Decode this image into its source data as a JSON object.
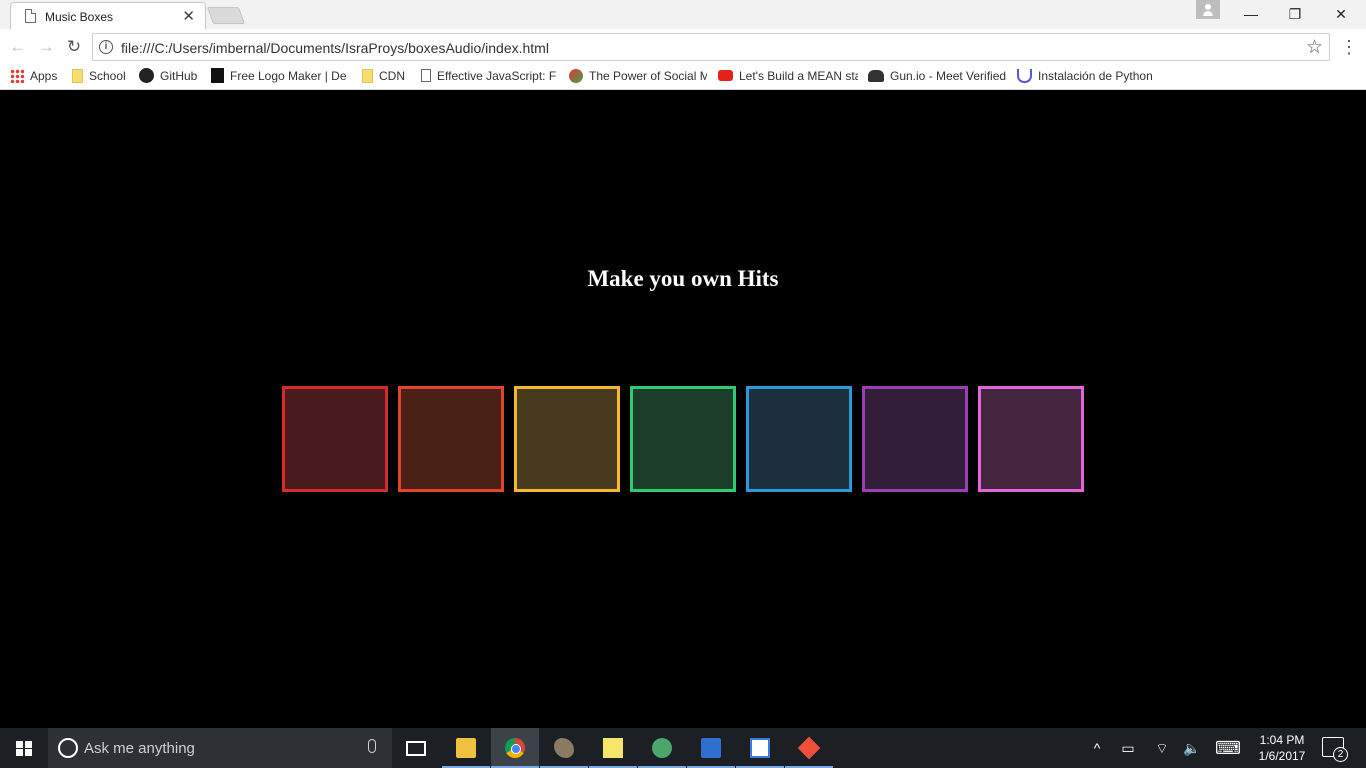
{
  "browser": {
    "tab_title": "Music Boxes",
    "tab_close": "✕",
    "window_controls": {
      "minimize": "—",
      "maximize": "❐",
      "close": "✕"
    },
    "url": "file:///C:/Users/imbernal/Documents/IsraProys/boxesAudio/index.html",
    "nav": {
      "back": "←",
      "forward": "→",
      "reload": "↻",
      "bookmark_star": "☆",
      "menu": "⋮"
    },
    "bookmarks": [
      {
        "label": "Apps",
        "icon": "apps-grid-icon"
      },
      {
        "label": "School",
        "icon": "folder-icon"
      },
      {
        "label": "GitHub",
        "icon": "github-icon"
      },
      {
        "label": "Free Logo Maker | De",
        "icon": "logo-maker-icon"
      },
      {
        "label": "CDN",
        "icon": "folder-icon"
      },
      {
        "label": "Effective JavaScript: Fr",
        "icon": "page-icon"
      },
      {
        "label": "The Power of Social M",
        "icon": "social-icon"
      },
      {
        "label": "Let's Build a MEAN sta",
        "icon": "youtube-icon"
      },
      {
        "label": "Gun.io - Meet Verified",
        "icon": "gun-io-icon"
      },
      {
        "label": "Instalación de Python",
        "icon": "udemy-icon"
      }
    ]
  },
  "page": {
    "title": "Make you own Hits",
    "boxes": [
      {
        "border_color": "#d42b2b",
        "fill_color": "#4a1b1e"
      },
      {
        "border_color": "#e0452b",
        "fill_color": "#4a2117"
      },
      {
        "border_color": "#f4b830",
        "fill_color": "#483a1d"
      },
      {
        "border_color": "#2ecc71",
        "fill_color": "#1c3d2a"
      },
      {
        "border_color": "#2e98d9",
        "fill_color": "#1b2f3d"
      },
      {
        "border_color": "#9b3fb5",
        "fill_color": "#321e38"
      },
      {
        "border_color": "#e266d9",
        "fill_color": "#43263e"
      }
    ]
  },
  "taskbar": {
    "search_placeholder": "Ask me anything",
    "apps": [
      "task-view",
      "file-explorer",
      "chrome",
      "gimp",
      "sticky-notes",
      "atom",
      "security-app",
      "paint",
      "git-client"
    ],
    "tray": {
      "chevron": "^",
      "battery": "▭",
      "wifi": "⌔",
      "volume": "🔈",
      "keyboard": "⌨"
    },
    "time": "1:04 PM",
    "date": "1/6/2017",
    "notification_count": "2"
  }
}
